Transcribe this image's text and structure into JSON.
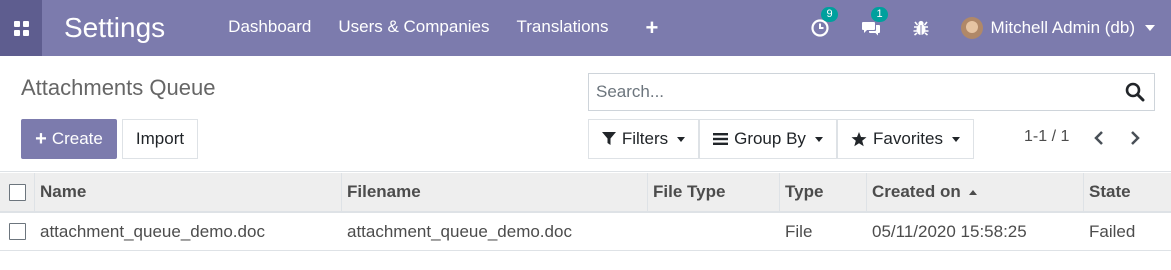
{
  "navbar": {
    "app_title": "Settings",
    "menu": [
      "Dashboard",
      "Users & Companies",
      "Translations"
    ],
    "plus_label": "+",
    "activity_count": "9",
    "messages_count": "1",
    "debug_icon": "bug-icon",
    "user_name": "Mitchell Admin (db)",
    "bg_color": "#7c7bad",
    "apps_bg_color": "#5e5d8f",
    "badge_color": "#00a09d"
  },
  "control_panel": {
    "breadcrumb": "Attachments Queue",
    "search_placeholder": "Search...",
    "create_label": "Create",
    "import_label": "Import",
    "filters_label": "Filters",
    "groupby_label": "Group By",
    "favorites_label": "Favorites",
    "pager_value": "1-1 / 1"
  },
  "list": {
    "columns": [
      "Name",
      "Filename",
      "File Type",
      "Type",
      "Created on",
      "State"
    ],
    "sorted_column": "Created on",
    "sort_direction": "ascending",
    "rows": [
      {
        "name": "attachment_queue_demo.doc",
        "filename": "attachment_queue_demo.doc",
        "file_type": "",
        "type": "File",
        "created_on": "05/11/2020 15:58:25",
        "state": "Failed"
      }
    ]
  }
}
